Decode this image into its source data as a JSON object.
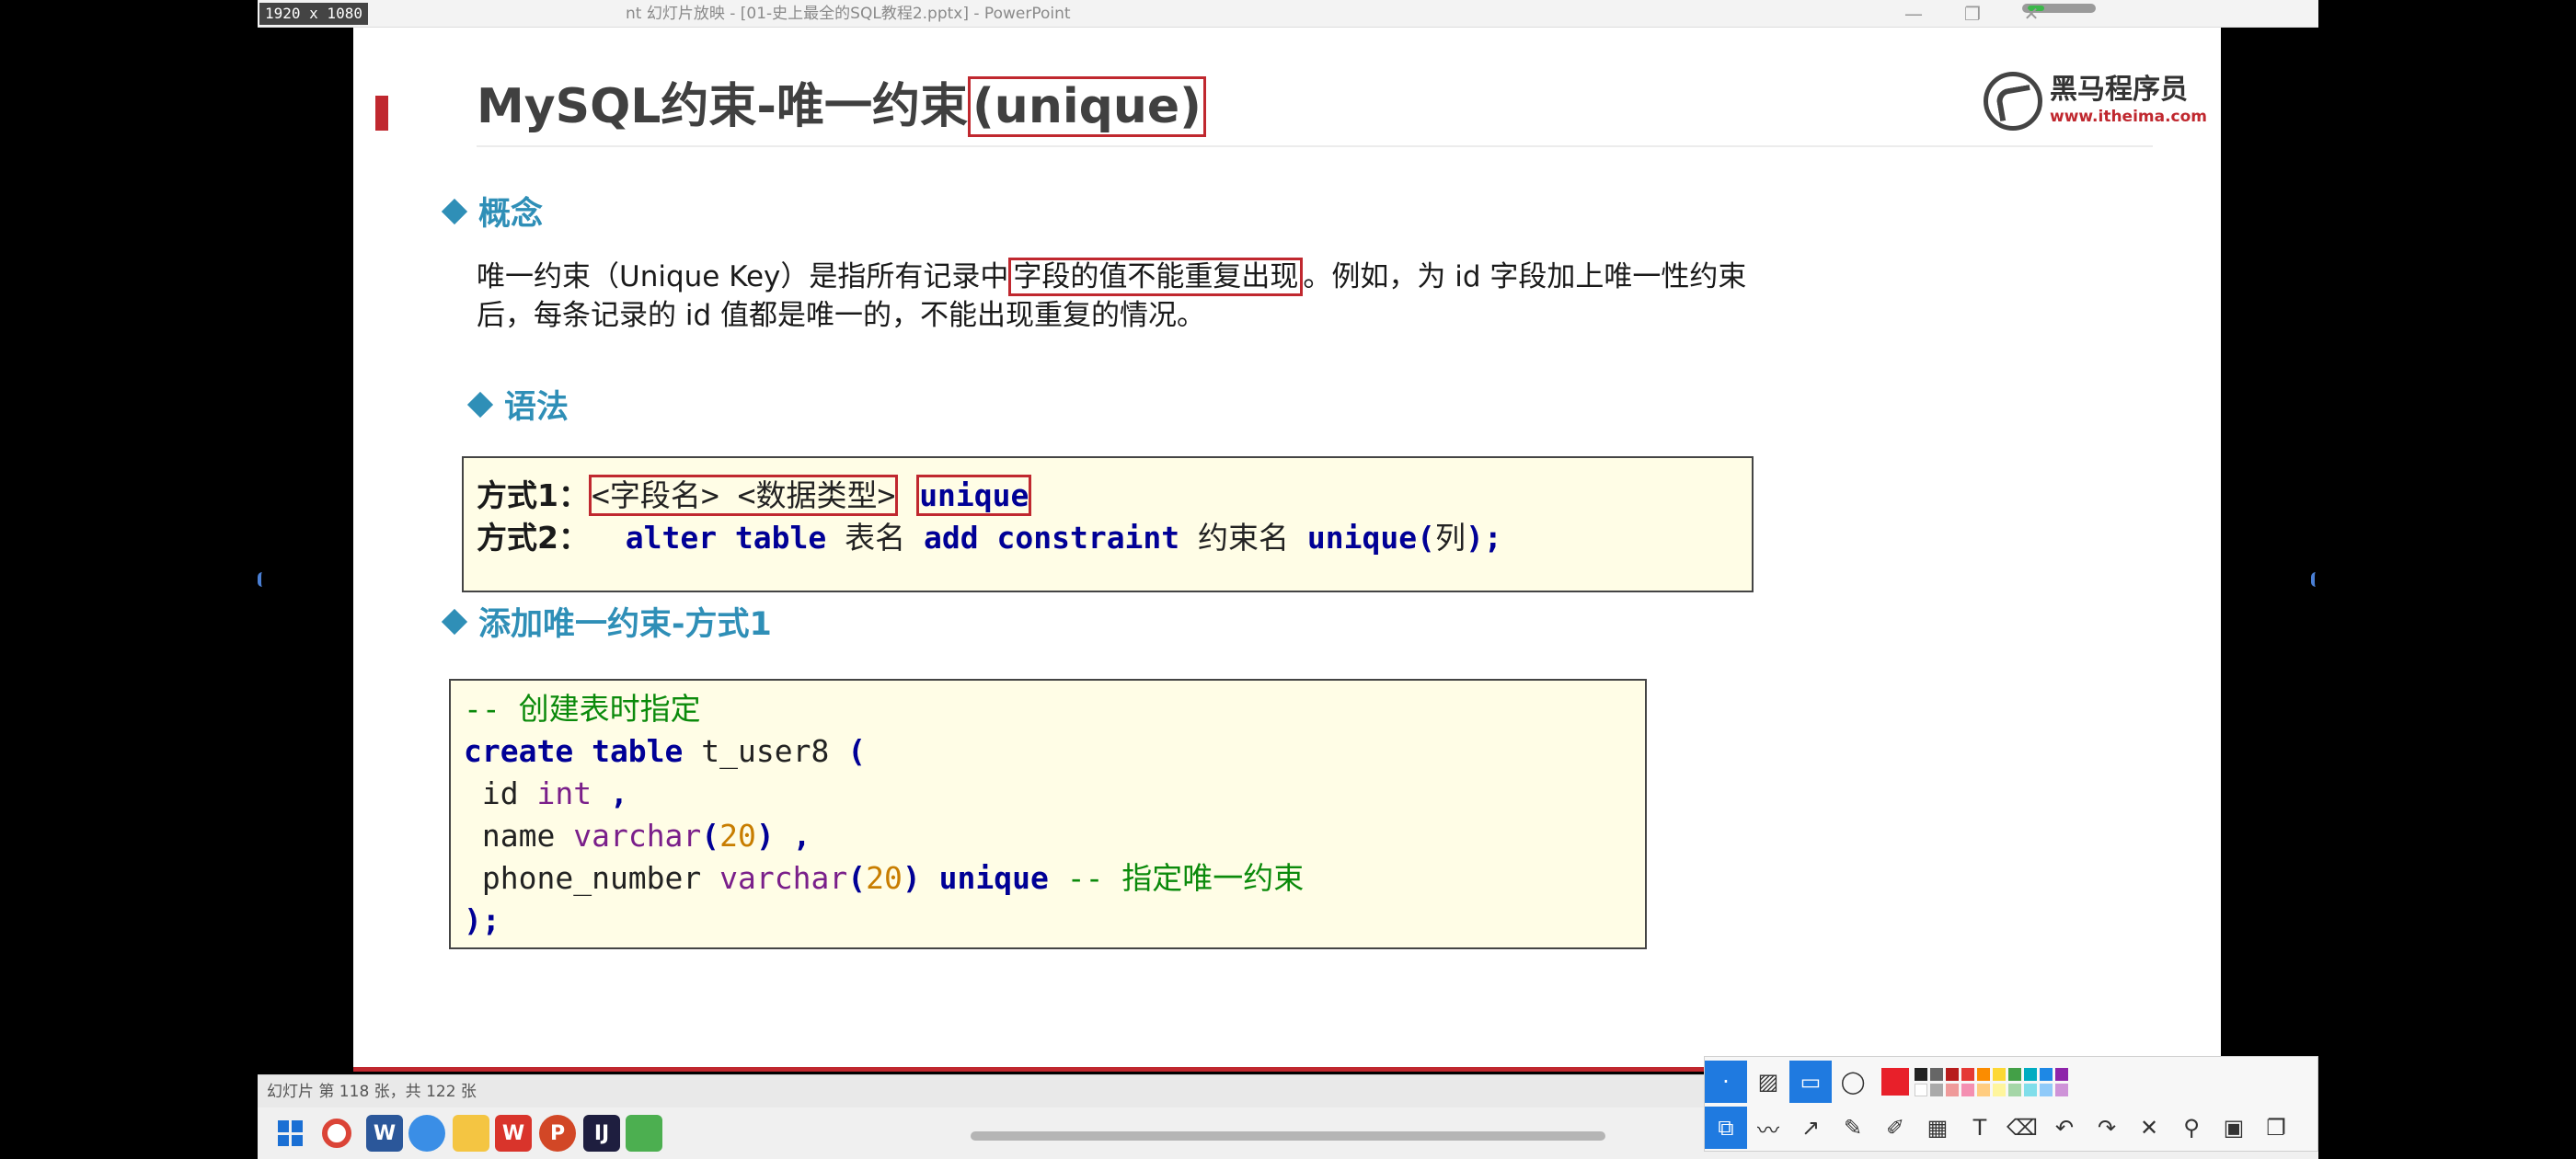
{
  "window": {
    "resolution": "1920 x 1080",
    "title": "nt 幻灯片放映 - [01-史上最全的SQL教程2.pptx] - PowerPoint",
    "controls": {
      "minimize": "—",
      "restore": "❐",
      "close": "✕"
    }
  },
  "slide": {
    "title_pre": "MySQL约束-唯一约束",
    "title_boxed": "(unique)",
    "logo": {
      "name": "黑马程序员",
      "url": "www.itheima.com"
    },
    "sections": {
      "concept": "概念",
      "syntax": "语法",
      "add": "添加唯一约束-方式1"
    },
    "concept": {
      "line1_pre": "唯一约束（Unique Key）是指所有记录中",
      "line1_boxed": "字段的值不能重复出现",
      "line1_post": "。例如，为 id 字段加上唯一性约束",
      "line2": "后，每条记录的 id 值都是唯一的，不能出现重复的情况。"
    },
    "syntax": {
      "l1_label": "方式1：",
      "l1_boxed": "<字段名> <数据类型>",
      "l1_kw": "unique",
      "l2_label": "方式2：",
      "l2_kw1": "alter table",
      "l2_t1": "表名",
      "l2_kw2": "add constraint",
      "l2_t2": "约束名",
      "l2_kw3": "unique",
      "l2_p1": "(",
      "l2_t3": "列",
      "l2_p2": ");"
    },
    "code": {
      "c1": "-- 创建表时指定",
      "l2_kw": "create table",
      "l2_name": "t_user8",
      "l2_paren": "(",
      "l3_col": " id",
      "l3_type": "int",
      "l3_comma": ",",
      "l4_col": " name",
      "l4_type": "varchar",
      "l4_p1": "(",
      "l4_num": "20",
      "l4_p2": ")",
      "l4_comma": ",",
      "l5_col": " phone_number",
      "l5_type": "varchar",
      "l5_p1": "(",
      "l5_num": "20",
      "l5_p2": ")",
      "l5_kw": "unique",
      "l5_cm": "-- 指定唯一约束",
      "l6": ");"
    }
  },
  "status_bar": {
    "slide_count": "幻灯片 第 118 张，共 122 张"
  },
  "taskbar": {
    "apps": [
      "start-icon",
      "chrome-icon",
      "word-icon",
      "browser-icon",
      "file-explorer-icon",
      "wps-icon",
      "powerpoint-icon",
      "intellij-icon",
      "photos-icon"
    ]
  },
  "annotation_toolbar": {
    "row1": [
      "pointer",
      "hatch",
      "rectangle",
      "ellipse"
    ],
    "row2": [
      "select",
      "polyline",
      "arrow",
      "pen",
      "highlighter",
      "mosaic",
      "text",
      "eraser",
      "undo",
      "redo",
      "close",
      "pin",
      "save",
      "copy"
    ]
  },
  "colors": {
    "accent": "#c0282f",
    "heading": "#2f8fb7",
    "code_bg": "#fffde6",
    "keyword": "#000096",
    "comment": "#0b8a0b"
  }
}
